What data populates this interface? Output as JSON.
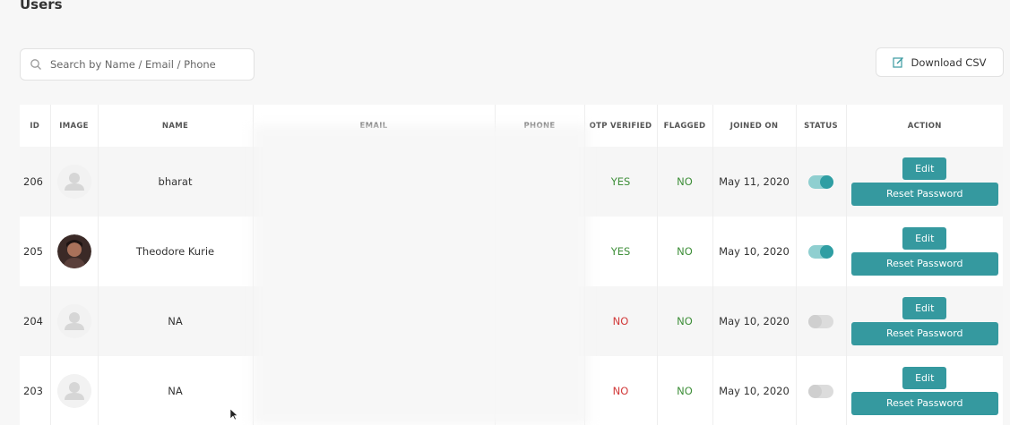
{
  "page": {
    "title": "Users"
  },
  "search": {
    "placeholder": "Search by Name / Email / Phone"
  },
  "toolbar": {
    "download_label": "Download CSV"
  },
  "table": {
    "columns": [
      "ID",
      "IMAGE",
      "NAME",
      "EMAIL",
      "PHONE",
      "OTP VERIFIED",
      "FLAGGED",
      "JOINED ON",
      "STATUS",
      "ACTION"
    ],
    "rows": [
      {
        "id": "206",
        "name": "bharat",
        "email": "",
        "phone": "",
        "otp_verified": "YES",
        "flagged": "NO",
        "joined_on": "May 11, 2020",
        "status": true,
        "edit": "Edit",
        "reset": "Reset Password"
      },
      {
        "id": "205",
        "name": "Theodore Kurie",
        "email": "",
        "phone": "",
        "otp_verified": "YES",
        "flagged": "NO",
        "joined_on": "May 10, 2020",
        "status": true,
        "edit": "Edit",
        "reset": "Reset Password"
      },
      {
        "id": "204",
        "name": "NA",
        "email": "",
        "phone": "",
        "otp_verified": "NO",
        "flagged": "NO",
        "joined_on": "May 10, 2020",
        "status": false,
        "edit": "Edit",
        "reset": "Reset Password"
      },
      {
        "id": "203",
        "name": "NA",
        "email": "",
        "phone": "",
        "otp_verified": "NO",
        "flagged": "NO",
        "joined_on": "May 10, 2020",
        "status": false,
        "edit": "Edit",
        "reset": "Reset Password"
      }
    ]
  },
  "colors": {
    "accent": "#35999f",
    "yes": "#3f8f3a",
    "no": "#d23a3a"
  }
}
